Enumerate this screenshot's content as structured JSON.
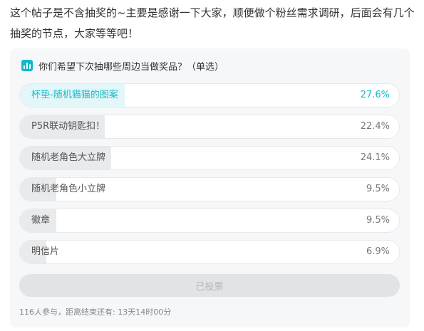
{
  "post": {
    "text": "这个帖子是不含抽奖的~主要是感谢一下大家，顺便做个粉丝需求调研，后面会有几个抽奖的节点，大家等等吧！"
  },
  "poll": {
    "icon": "bar-chart-icon",
    "accent_color": "#1ab8c9",
    "title": "你们希望下次抽哪些周边当做奖品？（单选）",
    "options": [
      {
        "label": "杯垫-随机猫猫的图案",
        "percent_text": "27.6%",
        "percent": 27.6,
        "selected": true
      },
      {
        "label": "P5R联动钥匙扣！",
        "percent_text": "22.4%",
        "percent": 22.4,
        "selected": false
      },
      {
        "label": "随机老角色大立牌",
        "percent_text": "24.1%",
        "percent": 24.1,
        "selected": false
      },
      {
        "label": "随机老角色小立牌",
        "percent_text": "9.5%",
        "percent": 9.5,
        "selected": false
      },
      {
        "label": "徽章",
        "percent_text": "9.5%",
        "percent": 9.5,
        "selected": false
      },
      {
        "label": "明信片",
        "percent_text": "6.9%",
        "percent": 6.9,
        "selected": false
      }
    ],
    "voted_label": "已投票",
    "footer": "116人参与，距离结束还有: 13天14时00分"
  }
}
